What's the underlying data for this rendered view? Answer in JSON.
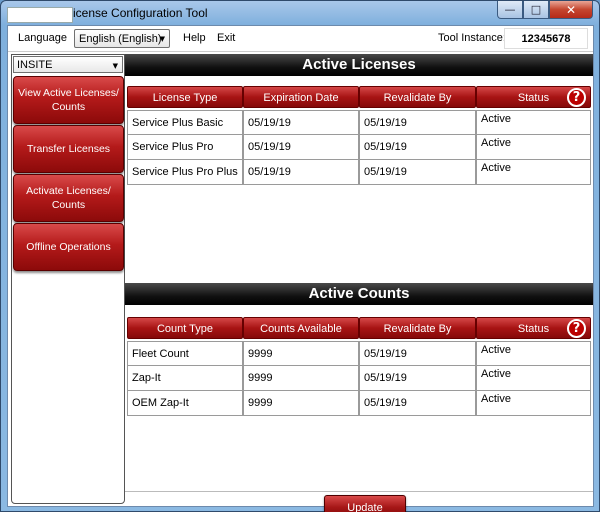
{
  "window": {
    "title": "License Configuration Tool",
    "title_visible": "icense Configuration Tool",
    "min_glyph": "—",
    "max_glyph": "□",
    "close_glyph": "✕"
  },
  "menu": {
    "language_label": "Language",
    "language_value": "English (English)",
    "help": "Help",
    "exit": "Exit",
    "tool_instance_label": "Tool Instance:",
    "tool_instance_value": "12345678"
  },
  "sidebar": {
    "select_value": "INSITE",
    "items": [
      {
        "line1": "View Active Licenses/",
        "line2": "Counts"
      },
      {
        "line1": "Transfer Licenses",
        "line2": ""
      },
      {
        "line1": "Activate Licenses/",
        "line2": "Counts"
      },
      {
        "line1": "Offline Operations",
        "line2": ""
      }
    ]
  },
  "licenses": {
    "title": "Active Licenses",
    "columns": [
      "License Type",
      "Expiration Date",
      "Revalidate By",
      "Status"
    ],
    "rows": [
      [
        "Service Plus Basic",
        "05/19/19",
        "05/19/19",
        "Active"
      ],
      [
        "Service Plus Pro",
        "05/19/19",
        "05/19/19",
        "Active"
      ],
      [
        "Service Plus Pro Plus",
        "05/19/19",
        "05/19/19",
        "Active"
      ]
    ]
  },
  "counts": {
    "title": "Active Counts",
    "columns": [
      "Count Type",
      "Counts Available",
      "Revalidate By",
      "Status"
    ],
    "rows": [
      [
        "Fleet Count",
        "9999",
        "05/19/19",
        "Active"
      ],
      [
        "Zap-It",
        "9999",
        "05/19/19",
        "Active"
      ],
      [
        "OEM Zap-It",
        "9999",
        "05/19/19",
        "Active"
      ]
    ]
  },
  "help_glyph": "?",
  "update_button": "Update Licenses",
  "colors": {
    "accent_red": "#b41a1a",
    "header_black": "#000000"
  }
}
